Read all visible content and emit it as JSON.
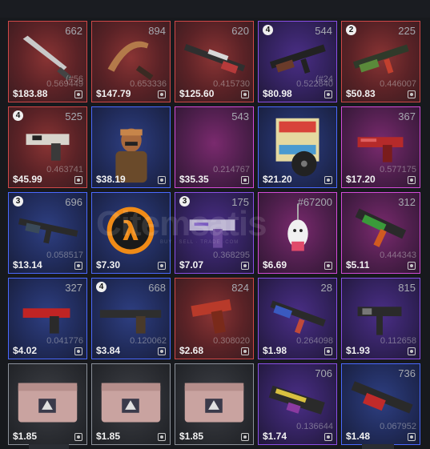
{
  "items": [
    {
      "count": "662",
      "badge": "",
      "price": "$183.88",
      "float": "0.569449",
      "float2": "(#56",
      "rarity": "red",
      "art": "knife"
    },
    {
      "count": "894",
      "badge": "",
      "price": "$147.79",
      "float": "0.653336",
      "float2": "",
      "rarity": "red",
      "art": "karambit"
    },
    {
      "count": "620",
      "badge": "",
      "price": "$125.60",
      "float": "0.415730",
      "float2": "",
      "rarity": "red",
      "art": "awp"
    },
    {
      "count": "544",
      "badge": "4",
      "price": "$80.98",
      "float": "0.522840",
      "float2": "(#24",
      "rarity": "purple",
      "art": "ak"
    },
    {
      "count": "225",
      "badge": "2",
      "price": "$50.83",
      "float": "0.446007",
      "float2": "",
      "rarity": "red",
      "art": "ak-green"
    },
    {
      "count": "525",
      "badge": "4",
      "price": "$45.99",
      "float": "0.463741",
      "float2": "",
      "rarity": "red",
      "art": "deagle"
    },
    {
      "count": "",
      "badge": "",
      "price": "$38.19",
      "float": "",
      "float2": "",
      "rarity": "blue",
      "art": "agent"
    },
    {
      "count": "543",
      "badge": "",
      "price": "$35.35",
      "float": "0.214767",
      "float2": "",
      "rarity": "pink",
      "art": "ak-white"
    },
    {
      "count": "",
      "badge": "",
      "price": "$21.20",
      "float": "",
      "float2": "",
      "rarity": "blue",
      "art": "music"
    },
    {
      "count": "367",
      "badge": "",
      "price": "$17.20",
      "float": "0.577175",
      "float2": "",
      "rarity": "pink",
      "art": "pistol-red"
    },
    {
      "count": "696",
      "badge": "3",
      "price": "$13.14",
      "float": "0.058517",
      "float2": "",
      "rarity": "blue",
      "art": "m4"
    },
    {
      "count": "",
      "badge": "",
      "price": "$7.30",
      "float": "",
      "float2": "",
      "rarity": "blue",
      "art": "halflife"
    },
    {
      "count": "175",
      "badge": "3",
      "price": "$7.07",
      "float": "0.368295",
      "float2": "",
      "rarity": "purple",
      "art": "pistol-purple"
    },
    {
      "count": "#67200",
      "badge": "",
      "price": "$6.69",
      "float": "",
      "float2": "",
      "rarity": "pink",
      "art": "charm"
    },
    {
      "count": "312",
      "badge": "",
      "price": "$5.11",
      "float": "0.444343",
      "float2": "",
      "rarity": "pink",
      "art": "mp9"
    },
    {
      "count": "327",
      "badge": "",
      "price": "$4.02",
      "float": "0.041776",
      "float2": "",
      "rarity": "blue",
      "art": "p2000"
    },
    {
      "count": "668",
      "badge": "4",
      "price": "$3.84",
      "float": "0.120062",
      "float2": "",
      "rarity": "blue",
      "art": "usp"
    },
    {
      "count": "824",
      "badge": "",
      "price": "$2.68",
      "float": "0.308020",
      "float2": "",
      "rarity": "red",
      "art": "p250"
    },
    {
      "count": "28",
      "badge": "",
      "price": "$1.98",
      "float": "0.264098",
      "float2": "",
      "rarity": "purple",
      "art": "ak-blue"
    },
    {
      "count": "815",
      "badge": "",
      "price": "$1.93",
      "float": "0.112658",
      "float2": "",
      "rarity": "purple",
      "art": "tec9"
    },
    {
      "count": "",
      "badge": "",
      "price": "$1.85",
      "float": "",
      "float2": "",
      "rarity": "gray",
      "art": "case"
    },
    {
      "count": "",
      "badge": "",
      "price": "$1.85",
      "float": "",
      "float2": "",
      "rarity": "gray",
      "art": "case"
    },
    {
      "count": "",
      "badge": "",
      "price": "$1.85",
      "float": "",
      "float2": "",
      "rarity": "gray",
      "art": "case"
    },
    {
      "count": "706",
      "badge": "",
      "price": "$1.74",
      "float": "0.136644",
      "float2": "",
      "rarity": "purple",
      "art": "p90"
    },
    {
      "count": "736",
      "badge": "",
      "price": "$1.48",
      "float": "0.067952",
      "float2": "",
      "rarity": "blue",
      "art": "negev"
    }
  ],
  "watermark": {
    "text": "Citemsatis",
    "sub": "BUY · SELL · TRADE ·COM"
  }
}
